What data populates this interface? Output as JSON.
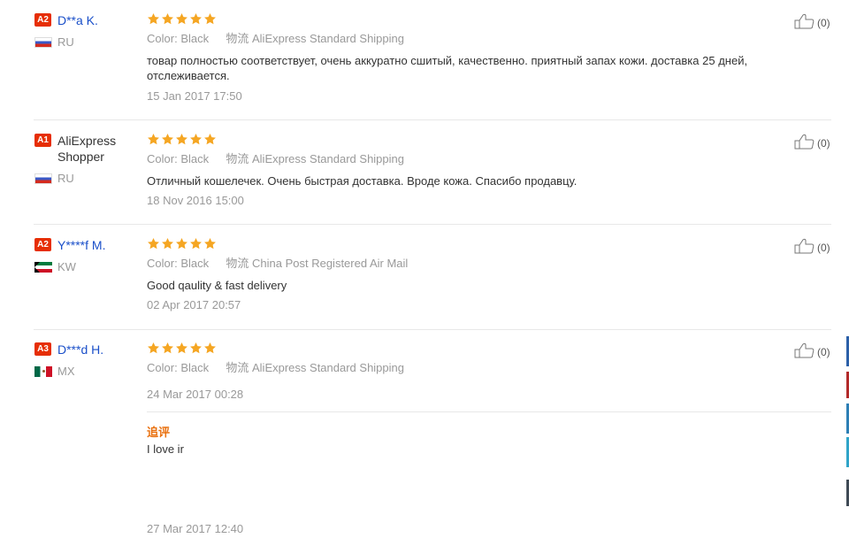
{
  "reviews": [
    {
      "level": "A2",
      "user": "D**a K.",
      "country": "RU",
      "color_label": "Color:",
      "color_value": "Black",
      "logistics_label": "物流",
      "shipping": "AliExpress Standard Shipping",
      "text": "товар полностью соответствует, очень аккуратно сшитый, качественно. приятный запах кожи. доставка 25 дней, отслеживается.",
      "date": "15 Jan 2017 17:50",
      "helpful": "(0)",
      "stars": 5
    },
    {
      "level": "A1",
      "user": "AliExpress Shopper",
      "country": "RU",
      "color_label": "Color:",
      "color_value": "Black",
      "logistics_label": "物流",
      "shipping": "AliExpress Standard Shipping",
      "text": "Отличный кошелечек. Очень быстрая доставка. Вроде кожа. Спасибо продавцу.",
      "date": "18 Nov 2016 15:00",
      "helpful": "(0)",
      "stars": 5
    },
    {
      "level": "A2",
      "user": "Y****f M.",
      "country": "KW",
      "color_label": "Color:",
      "color_value": "Black",
      "logistics_label": "物流",
      "shipping": "China Post Registered Air Mail",
      "text": "Good qaulity & fast delivery",
      "date": "02 Apr 2017 20:57",
      "helpful": "(0)",
      "stars": 5
    },
    {
      "level": "A3",
      "user": "D***d H.",
      "country": "MX",
      "color_label": "Color:",
      "color_value": "Black",
      "logistics_label": "物流",
      "shipping": "AliExpress Standard Shipping",
      "date": "24 Mar 2017 00:28",
      "helpful": "(0)",
      "stars": 5,
      "followup": {
        "title": "追评",
        "text": "I love ir",
        "date": "27 Mar 2017 12:40"
      }
    }
  ],
  "colors": {
    "user_link": "#1a4fc9",
    "level_badge": "#e62e04",
    "star": "#f5a623",
    "followup_title": "#e9700e",
    "muted": "#999999"
  },
  "icons": {
    "rating": "star-icon",
    "helpful": "thumbs-up-icon"
  }
}
